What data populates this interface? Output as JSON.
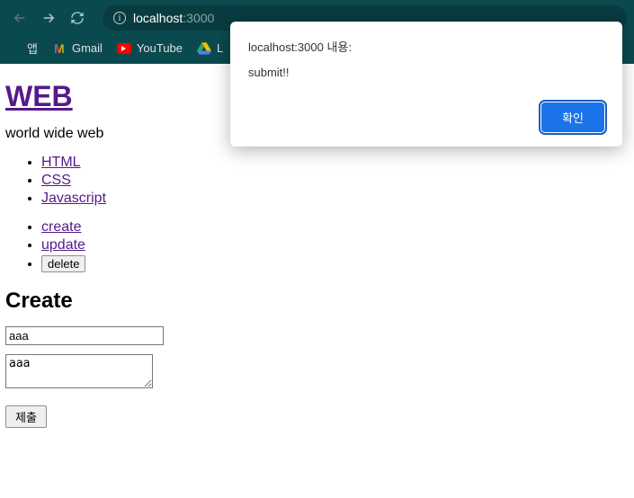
{
  "browser": {
    "url_host": "localhost",
    "url_port": ":3000",
    "bookmarks": {
      "apps": "앱",
      "gmail": "Gmail",
      "youtube": "YouTube",
      "drive_initial": "L"
    }
  },
  "alert": {
    "title": "localhost:3000 내용:",
    "message": "submit!!",
    "ok_label": "확인"
  },
  "page": {
    "heading_link": "WEB",
    "subtitle": "world wide web",
    "topics": [
      "HTML",
      "CSS",
      "Javascript"
    ],
    "actions_links": [
      "create",
      "update"
    ],
    "delete_label": "delete",
    "form_heading": "Create",
    "title_value": "aaa",
    "body_value": "aaa",
    "submit_label": "제출"
  }
}
